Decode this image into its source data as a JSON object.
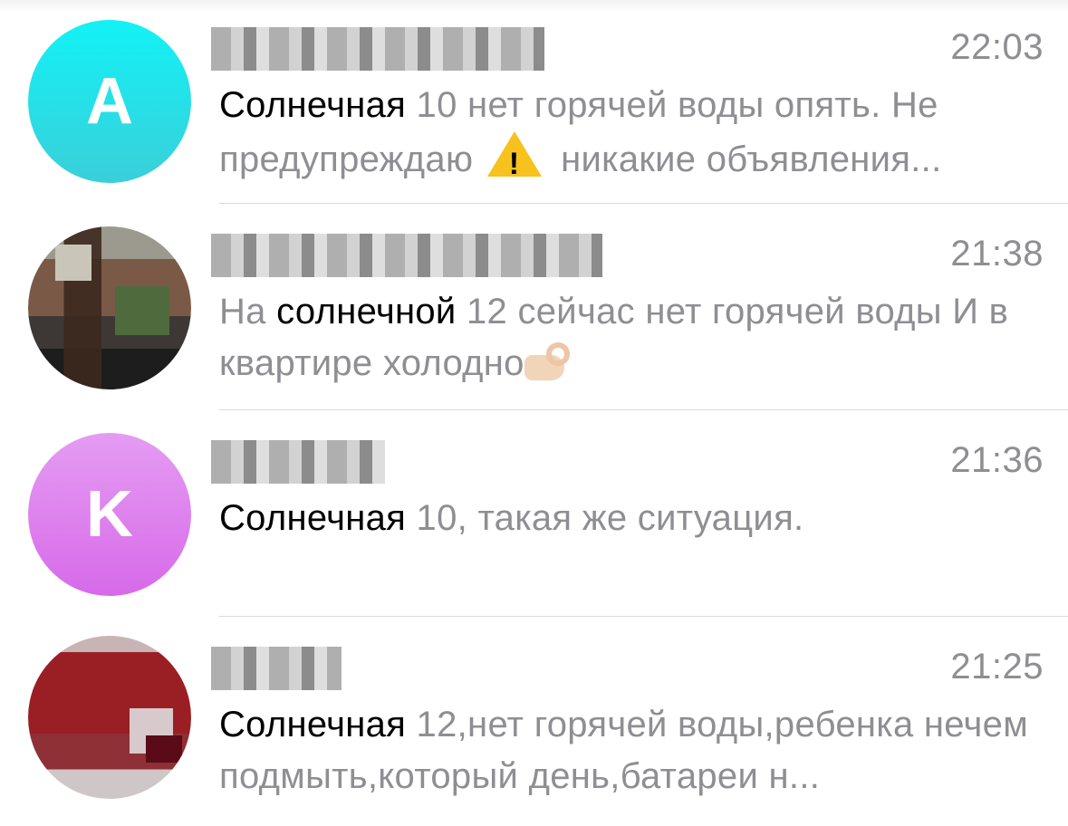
{
  "chats": [
    {
      "avatar_letter": "A",
      "avatar_color": "#2fe0e8",
      "time": "22:03",
      "preview_highlight": "Солнечная",
      "preview_rest_1": " 10 нет горячей воды опять. Не предупреждаю ",
      "preview_emoji": "warning-icon",
      "preview_rest_2": " никакие объявления..."
    },
    {
      "avatar_letter": "",
      "time": "21:38",
      "preview_prefix": "На ",
      "preview_highlight": "солнечной",
      "preview_rest_1": " 12 сейчас нет горячей воды И в квартире холодно",
      "preview_emoji": "pinching-hand-icon"
    },
    {
      "avatar_letter": "K",
      "avatar_color": "#dd7cee",
      "time": "21:36",
      "preview_highlight": "Солнечная",
      "preview_rest_1": " 10, такая же ситуация."
    },
    {
      "avatar_letter": "",
      "time": "21:25",
      "preview_highlight": "Солнечная",
      "preview_rest_1": " 12,нет горячей воды,ребенка нечем подмыть,который день,батареи н..."
    }
  ]
}
